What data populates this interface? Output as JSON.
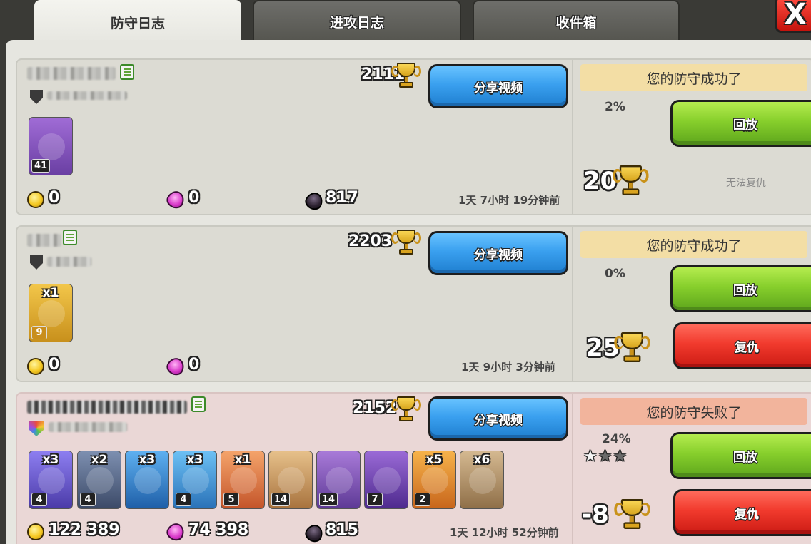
{
  "tabs": [
    {
      "label": "防守日志",
      "active": true
    },
    {
      "label": "进攻日志",
      "active": false
    },
    {
      "label": "收件箱",
      "active": false
    }
  ],
  "close_label": "X",
  "share_label": "分享视频",
  "replay_label": "回放",
  "revenge_label": "复仇",
  "no_revenge_label": "无法复仇",
  "entries": [
    {
      "result": "您的防守成功了",
      "percent": "2%",
      "attacker_trophies": "2111",
      "trophy_change": "20",
      "gold": "0",
      "elixir": "0",
      "dark_elixir": "817",
      "time": "1天 7小时 19分钟前",
      "units": [
        {
          "count": "",
          "level": "41",
          "name": "archer-queen"
        }
      ]
    },
    {
      "result": "您的防守成功了",
      "percent": "0%",
      "attacker_trophies": "2203",
      "trophy_change": "25",
      "gold": "0",
      "elixir": "0",
      "time": "1天 9小时 3分钟前",
      "units": [
        {
          "count": "x1",
          "level": "9",
          "name": "barbarian"
        }
      ]
    },
    {
      "result": "您的防守失败了",
      "percent": "24%",
      "stars": 1,
      "attacker_trophies": "2152",
      "trophy_change": "-8",
      "gold": "122 389",
      "elixir": "74 398",
      "dark_elixir": "815",
      "time": "1天 12小时 52分钟前",
      "units": [
        {
          "count": "x3",
          "level": "4",
          "name": "dragon",
          "color": "#6b5bd6"
        },
        {
          "count": "x2",
          "level": "4",
          "name": "pekka",
          "color": "#5b6d8e"
        },
        {
          "count": "x3",
          "level": "",
          "name": "electro-dragon",
          "color": "#3f8fd6"
        },
        {
          "count": "x3",
          "level": "4",
          "name": "baby-dragon",
          "color": "#4aa3e0"
        },
        {
          "count": "x1",
          "level": "5",
          "name": "valkyrie",
          "color": "#e9823c"
        },
        {
          "count": "",
          "level": "14",
          "name": "barbarian-king",
          "color": "#d9a86a"
        },
        {
          "count": "",
          "level": "14",
          "name": "archer-queen",
          "color": "#8a5ac2"
        },
        {
          "count": "",
          "level": "7",
          "name": "grand-warden",
          "color": "#7a4fb8"
        },
        {
          "count": "x5",
          "level": "2",
          "name": "rage-spell",
          "color": "#e8932a"
        },
        {
          "count": "x6",
          "level": "",
          "name": "earthquake-spell",
          "color": "#b89a72"
        }
      ]
    }
  ]
}
